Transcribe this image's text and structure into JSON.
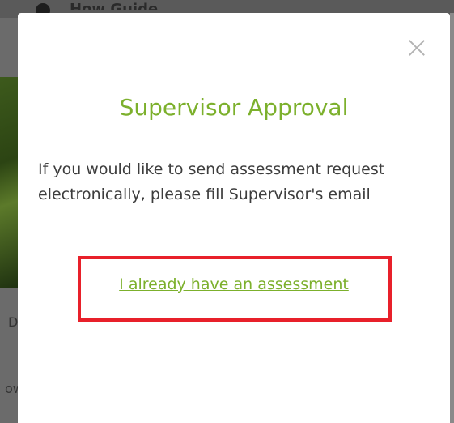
{
  "background": {
    "header_text": "How Guide",
    "left_text_1": "D",
    "left_text_2": "ow"
  },
  "modal": {
    "title": "Supervisor Approval",
    "message": "If you would like to send assessment request electronically, please fill Supervisor's email",
    "link_label": "I already have an assessment",
    "close_icon": "close-icon"
  },
  "colors": {
    "accent": "#7cb02c",
    "highlight": "#e8202a",
    "text": "#3d3d3d",
    "overlay": "#4a4a4a"
  }
}
